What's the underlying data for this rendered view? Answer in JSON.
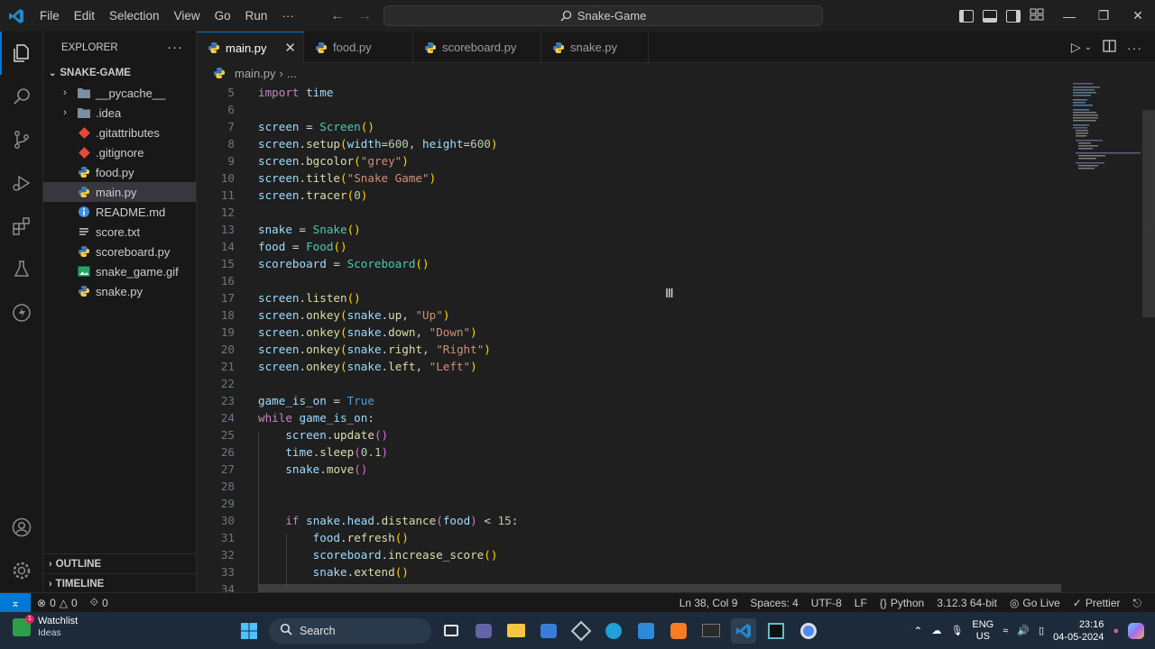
{
  "menu": [
    "File",
    "Edit",
    "Selection",
    "View",
    "Go",
    "Run",
    "···"
  ],
  "command_center": "Snake-Game",
  "explorer": {
    "title": "EXPLORER",
    "folder": "SNAKE-GAME",
    "items": [
      {
        "name": "__pycache__",
        "kind": "folder",
        "icon": "folder-icon"
      },
      {
        "name": ".idea",
        "kind": "folder",
        "icon": "folder-icon"
      },
      {
        "name": ".gitattributes",
        "kind": "file",
        "icon": "git-icon"
      },
      {
        "name": ".gitignore",
        "kind": "file",
        "icon": "git-icon"
      },
      {
        "name": "food.py",
        "kind": "file",
        "icon": "python-icon"
      },
      {
        "name": "main.py",
        "kind": "file",
        "icon": "python-icon",
        "selected": true
      },
      {
        "name": "README.md",
        "kind": "file",
        "icon": "info-icon"
      },
      {
        "name": "score.txt",
        "kind": "file",
        "icon": "text-icon"
      },
      {
        "name": "scoreboard.py",
        "kind": "file",
        "icon": "python-icon"
      },
      {
        "name": "snake_game.gif",
        "kind": "file",
        "icon": "image-icon"
      },
      {
        "name": "snake.py",
        "kind": "file",
        "icon": "python-icon"
      }
    ],
    "outline": "OUTLINE",
    "timeline": "TIMELINE"
  },
  "tabs": [
    {
      "label": "main.py",
      "active": true
    },
    {
      "label": "food.py"
    },
    {
      "label": "scoreboard.py"
    },
    {
      "label": "snake.py"
    }
  ],
  "breadcrumb": {
    "file": "main.py",
    "rest": "..."
  },
  "code": {
    "lines": [
      {
        "n": 5,
        "tokens": [
          [
            "kw",
            "import"
          ],
          [
            "op",
            " "
          ],
          [
            "var",
            "time"
          ]
        ]
      },
      {
        "n": 6,
        "tokens": []
      },
      {
        "n": 7,
        "tokens": [
          [
            "var",
            "screen"
          ],
          [
            "op",
            " = "
          ],
          [
            "cls",
            "Screen"
          ],
          [
            "p",
            "()"
          ]
        ]
      },
      {
        "n": 8,
        "tokens": [
          [
            "var",
            "screen"
          ],
          [
            "op",
            "."
          ],
          [
            "fn",
            "setup"
          ],
          [
            "p",
            "("
          ],
          [
            "var",
            "width"
          ],
          [
            "op",
            "="
          ],
          [
            "num",
            "600"
          ],
          [
            "op",
            ", "
          ],
          [
            "var",
            "height"
          ],
          [
            "op",
            "="
          ],
          [
            "num",
            "600"
          ],
          [
            "p",
            ")"
          ]
        ]
      },
      {
        "n": 9,
        "tokens": [
          [
            "var",
            "screen"
          ],
          [
            "op",
            "."
          ],
          [
            "fn",
            "bgcolor"
          ],
          [
            "p",
            "("
          ],
          [
            "str",
            "\"grey\""
          ],
          [
            "p",
            ")"
          ]
        ]
      },
      {
        "n": 10,
        "tokens": [
          [
            "var",
            "screen"
          ],
          [
            "op",
            "."
          ],
          [
            "fn",
            "title"
          ],
          [
            "p",
            "("
          ],
          [
            "str",
            "\"Snake Game\""
          ],
          [
            "p",
            ")"
          ]
        ]
      },
      {
        "n": 11,
        "tokens": [
          [
            "var",
            "screen"
          ],
          [
            "op",
            "."
          ],
          [
            "fn",
            "tracer"
          ],
          [
            "p",
            "("
          ],
          [
            "num",
            "0"
          ],
          [
            "p",
            ")"
          ]
        ]
      },
      {
        "n": 12,
        "tokens": []
      },
      {
        "n": 13,
        "tokens": [
          [
            "var",
            "snake"
          ],
          [
            "op",
            " = "
          ],
          [
            "cls",
            "Snake"
          ],
          [
            "p",
            "()"
          ]
        ]
      },
      {
        "n": 14,
        "tokens": [
          [
            "var",
            "food"
          ],
          [
            "op",
            " = "
          ],
          [
            "cls",
            "Food"
          ],
          [
            "p",
            "()"
          ]
        ]
      },
      {
        "n": 15,
        "tokens": [
          [
            "var",
            "scoreboard"
          ],
          [
            "op",
            " = "
          ],
          [
            "cls",
            "Scoreboard"
          ],
          [
            "p",
            "()"
          ]
        ]
      },
      {
        "n": 16,
        "tokens": []
      },
      {
        "n": 17,
        "tokens": [
          [
            "var",
            "screen"
          ],
          [
            "op",
            "."
          ],
          [
            "fn",
            "listen"
          ],
          [
            "p",
            "()"
          ]
        ]
      },
      {
        "n": 18,
        "tokens": [
          [
            "var",
            "screen"
          ],
          [
            "op",
            "."
          ],
          [
            "fn",
            "onkey"
          ],
          [
            "p",
            "("
          ],
          [
            "var",
            "snake"
          ],
          [
            "op",
            "."
          ],
          [
            "fn",
            "up"
          ],
          [
            "op",
            ", "
          ],
          [
            "str",
            "\"Up\""
          ],
          [
            "p",
            ")"
          ]
        ]
      },
      {
        "n": 19,
        "tokens": [
          [
            "var",
            "screen"
          ],
          [
            "op",
            "."
          ],
          [
            "fn",
            "onkey"
          ],
          [
            "p",
            "("
          ],
          [
            "var",
            "snake"
          ],
          [
            "op",
            "."
          ],
          [
            "fn",
            "down"
          ],
          [
            "op",
            ", "
          ],
          [
            "str",
            "\"Down\""
          ],
          [
            "p",
            ")"
          ]
        ]
      },
      {
        "n": 20,
        "tokens": [
          [
            "var",
            "screen"
          ],
          [
            "op",
            "."
          ],
          [
            "fn",
            "onkey"
          ],
          [
            "p",
            "("
          ],
          [
            "var",
            "snake"
          ],
          [
            "op",
            "."
          ],
          [
            "fn",
            "right"
          ],
          [
            "op",
            ", "
          ],
          [
            "str",
            "\"Right\""
          ],
          [
            "p",
            ")"
          ]
        ]
      },
      {
        "n": 21,
        "tokens": [
          [
            "var",
            "screen"
          ],
          [
            "op",
            "."
          ],
          [
            "fn",
            "onkey"
          ],
          [
            "p",
            "("
          ],
          [
            "var",
            "snake"
          ],
          [
            "op",
            "."
          ],
          [
            "fn",
            "left"
          ],
          [
            "op",
            ", "
          ],
          [
            "str",
            "\"Left\""
          ],
          [
            "p",
            ")"
          ]
        ]
      },
      {
        "n": 22,
        "tokens": []
      },
      {
        "n": 23,
        "tokens": [
          [
            "var",
            "game_is_on"
          ],
          [
            "op",
            " = "
          ],
          [
            "con",
            "True"
          ]
        ]
      },
      {
        "n": 24,
        "tokens": [
          [
            "kw",
            "while"
          ],
          [
            "op",
            " "
          ],
          [
            "var",
            "game_is_on"
          ],
          [
            "op",
            ":"
          ]
        ]
      },
      {
        "n": 25,
        "tokens": [
          [
            "op",
            "    "
          ],
          [
            "var",
            "screen"
          ],
          [
            "op",
            "."
          ],
          [
            "fn",
            "update"
          ],
          [
            "p2",
            "()"
          ]
        ]
      },
      {
        "n": 26,
        "tokens": [
          [
            "op",
            "    "
          ],
          [
            "var",
            "time"
          ],
          [
            "op",
            "."
          ],
          [
            "fn",
            "sleep"
          ],
          [
            "p2",
            "("
          ],
          [
            "num",
            "0.1"
          ],
          [
            "p2",
            ")"
          ]
        ]
      },
      {
        "n": 27,
        "tokens": [
          [
            "op",
            "    "
          ],
          [
            "var",
            "snake"
          ],
          [
            "op",
            "."
          ],
          [
            "fn",
            "move"
          ],
          [
            "p2",
            "()"
          ]
        ]
      },
      {
        "n": 28,
        "tokens": []
      },
      {
        "n": 29,
        "tokens": []
      },
      {
        "n": 30,
        "tokens": [
          [
            "op",
            "    "
          ],
          [
            "kw",
            "if"
          ],
          [
            "op",
            " "
          ],
          [
            "var",
            "snake"
          ],
          [
            "op",
            "."
          ],
          [
            "var",
            "head"
          ],
          [
            "op",
            "."
          ],
          [
            "fn",
            "distance"
          ],
          [
            "p2",
            "("
          ],
          [
            "var",
            "food"
          ],
          [
            "p2",
            ")"
          ],
          [
            "op",
            " < "
          ],
          [
            "num",
            "15"
          ],
          [
            "op",
            ":"
          ]
        ]
      },
      {
        "n": 31,
        "tokens": [
          [
            "op",
            "        "
          ],
          [
            "var",
            "food"
          ],
          [
            "op",
            "."
          ],
          [
            "fn",
            "refresh"
          ],
          [
            "p",
            "()"
          ]
        ]
      },
      {
        "n": 32,
        "tokens": [
          [
            "op",
            "        "
          ],
          [
            "var",
            "scoreboard"
          ],
          [
            "op",
            "."
          ],
          [
            "fn",
            "increase_score"
          ],
          [
            "p",
            "()"
          ]
        ]
      },
      {
        "n": 33,
        "tokens": [
          [
            "op",
            "        "
          ],
          [
            "var",
            "snake"
          ],
          [
            "op",
            "."
          ],
          [
            "fn",
            "extend"
          ],
          [
            "p",
            "()"
          ]
        ]
      },
      {
        "n": 34,
        "tokens": []
      }
    ],
    "colors": {
      "kw": "#c586c0",
      "var": "#9cdcfe",
      "fn": "#dcdcaa",
      "cls": "#4ec9b0",
      "str": "#ce9178",
      "num": "#b5cea8",
      "con": "#569cd6",
      "p": "#ffd700",
      "p2": "#da70d6",
      "op": "#d4d4d4"
    }
  },
  "status": {
    "errors": "0",
    "warnings": "0",
    "ports": "0",
    "position": "Ln 38, Col 9",
    "spaces": "Spaces: 4",
    "encoding": "UTF-8",
    "eol": "LF",
    "language": "Python",
    "interpreter": "3.12.3 64-bit",
    "golive": "Go Live",
    "prettier": "Prettier"
  },
  "taskbar": {
    "widget_title": "Watchlist",
    "widget_sub": "Ideas",
    "search": "Search",
    "lang1": "ENG",
    "lang2": "US",
    "time": "23:16",
    "date": "04-05-2024"
  },
  "accent": "#0078d4"
}
